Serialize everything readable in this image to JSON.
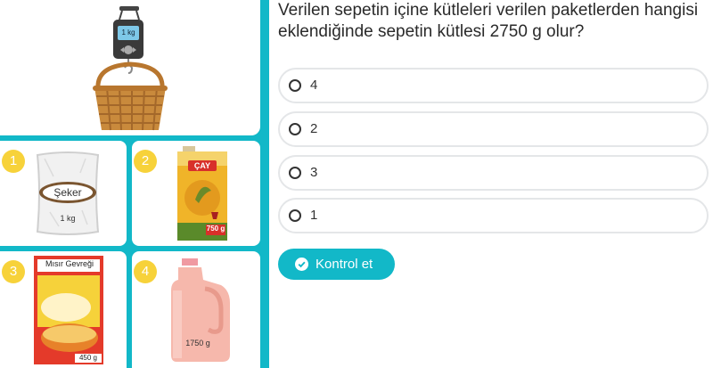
{
  "question": "Verilen sepetin içine kütleleri verilen paketlerden hangisi eklendiğinde sepetin kütlesi 2750 g olur?",
  "scale": {
    "display": "1 kg"
  },
  "items": [
    {
      "number": "1",
      "name": "Şeker",
      "mass": "1 kg"
    },
    {
      "number": "2",
      "name": "ÇAY",
      "mass": "750 g"
    },
    {
      "number": "3",
      "name": "Mısır Gevreği",
      "mass": "450 g"
    },
    {
      "number": "4",
      "name": "",
      "mass": "1750 g"
    }
  ],
  "options": [
    {
      "label": "4"
    },
    {
      "label": "2"
    },
    {
      "label": "3"
    },
    {
      "label": "1"
    }
  ],
  "submit_label": "Kontrol et",
  "colors": {
    "accent": "#12b8c8",
    "badge": "#f7d23a"
  }
}
